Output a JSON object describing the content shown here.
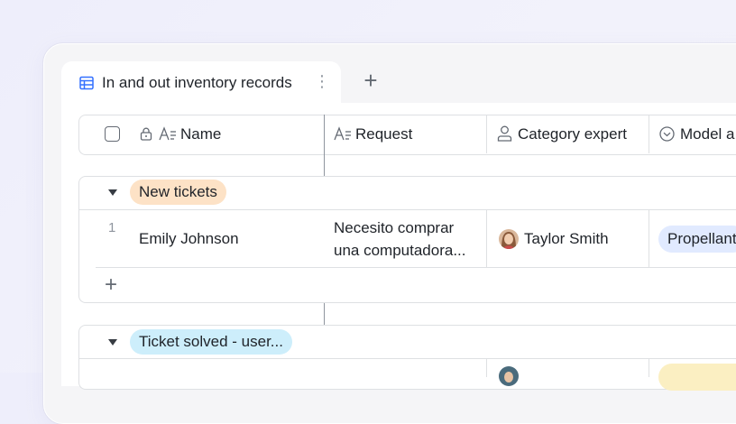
{
  "tab": {
    "label": "In and out inventory records",
    "more": "⋮",
    "add": "+"
  },
  "columns": [
    {
      "label": "Name"
    },
    {
      "label": "Request"
    },
    {
      "label": "Category expert"
    },
    {
      "label": "Model a"
    }
  ],
  "groups": [
    {
      "tag": "New tickets",
      "tag_color": "#fde2c6",
      "rows": [
        {
          "index": "1",
          "name": "Emily Johnson",
          "request_line1": "Necesito comprar",
          "request_line2": "una computadora...",
          "expert": "Taylor Smith",
          "model": "Propellant"
        }
      ],
      "add": "+"
    },
    {
      "tag": "Ticket solved - user...",
      "tag_color": "#cdeefb"
    }
  ],
  "colors": {
    "accent": "#3370ff",
    "border": "#dee0e3",
    "pill_blue": "#e1eaff",
    "pill_yellow": "#fbefc2"
  }
}
